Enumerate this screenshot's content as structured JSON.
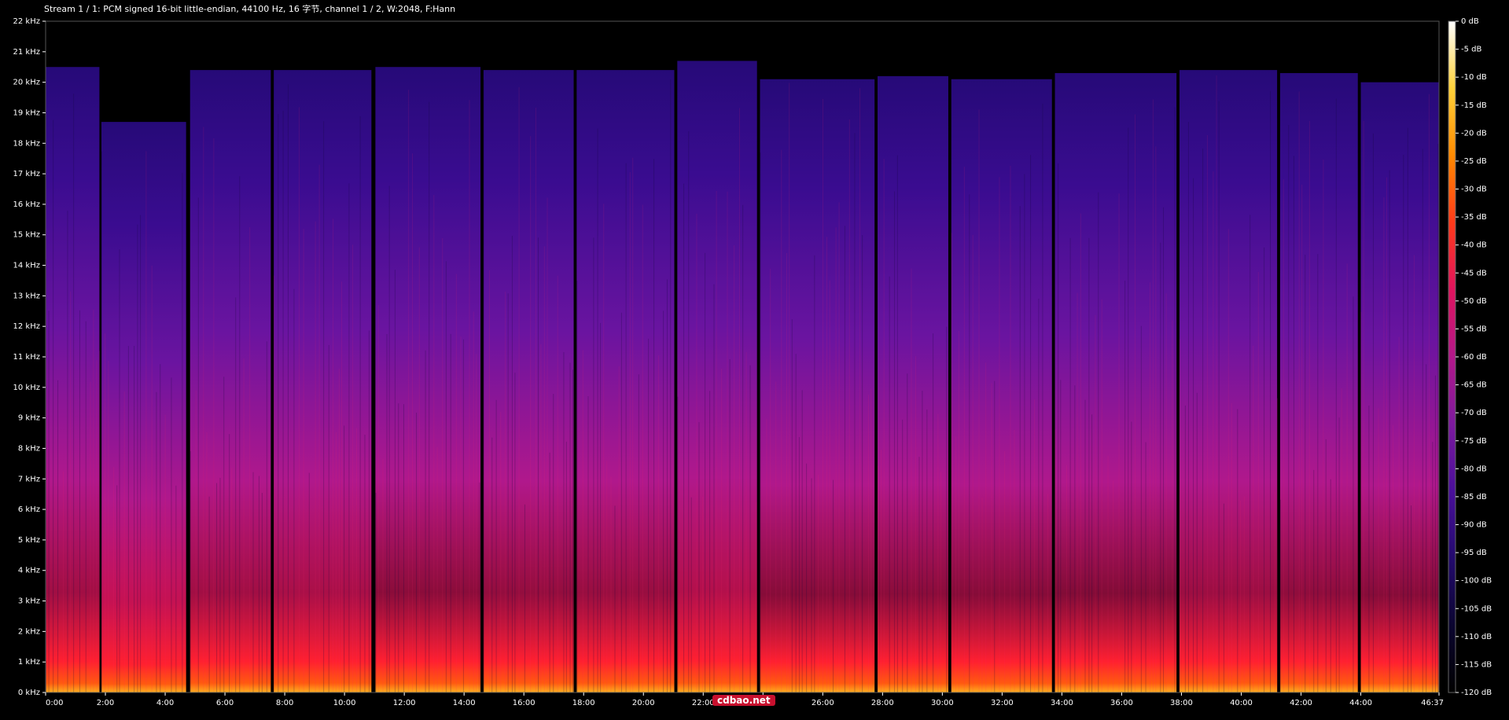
{
  "header": {
    "text": "Stream 1 / 1: PCM signed 16-bit little-endian, 44100 Hz, 16 字节, channel 1 / 2, W:2048, F:Hann"
  },
  "watermark": {
    "text": "cdbao.net"
  },
  "colors": {
    "background": "#000000",
    "text": "#ffffff",
    "colormap": [
      "#000000",
      "#0b0530",
      "#230a6e",
      "#4a0f9a",
      "#7d1a9e",
      "#b3188a",
      "#e0145e",
      "#ff3a1a",
      "#ff8a00",
      "#ffd23a",
      "#ffffff"
    ]
  },
  "chart_data": {
    "type": "heatmap",
    "title": "",
    "xlabel": "",
    "ylabel": "",
    "x_ticks": [
      "0:00",
      "2:00",
      "4:00",
      "6:00",
      "8:00",
      "10:00",
      "12:00",
      "14:00",
      "16:00",
      "18:00",
      "20:00",
      "22:00",
      "24:00",
      "26:00",
      "28:00",
      "30:00",
      "32:00",
      "34:00",
      "36:00",
      "38:00",
      "40:00",
      "42:00",
      "44:00",
      "46:37"
    ],
    "x_tick_seconds": [
      0,
      120,
      240,
      360,
      480,
      600,
      720,
      840,
      960,
      1080,
      1200,
      1320,
      1440,
      1560,
      1680,
      1800,
      1920,
      2040,
      2160,
      2280,
      2400,
      2520,
      2640,
      2797
    ],
    "xlim_seconds": [
      0,
      2797
    ],
    "y_ticks": [
      "0 kHz",
      "1 kHz",
      "2 kHz",
      "3 kHz",
      "4 kHz",
      "5 kHz",
      "6 kHz",
      "7 kHz",
      "8 kHz",
      "9 kHz",
      "10 kHz",
      "11 kHz",
      "12 kHz",
      "13 kHz",
      "14 kHz",
      "15 kHz",
      "16 kHz",
      "17 kHz",
      "18 kHz",
      "19 kHz",
      "20 kHz",
      "21 kHz",
      "22 kHz"
    ],
    "ylim_khz": [
      0,
      22
    ],
    "colorbar_ticks": [
      "0 dB",
      "-5 dB",
      "-10 dB",
      "-15 dB",
      "-20 dB",
      "-25 dB",
      "-30 dB",
      "-35 dB",
      "-40 dB",
      "-45 dB",
      "-50 dB",
      "-55 dB",
      "-60 dB",
      "-65 dB",
      "-70 dB",
      "-75 dB",
      "-80 dB",
      "-85 dB",
      "-90 dB",
      "-95 dB",
      "-100 dB",
      "-105 dB",
      "-110 dB",
      "-115 dB",
      "-120 dB"
    ],
    "colorbar_range_db": [
      -120,
      0
    ],
    "tracks": [
      {
        "start": 0,
        "end": 108,
        "cutoff_khz": 20.5,
        "intensity": 0.72
      },
      {
        "start": 112,
        "end": 282,
        "cutoff_khz": 18.7,
        "intensity": 0.88
      },
      {
        "start": 290,
        "end": 452,
        "cutoff_khz": 20.4,
        "intensity": 0.72
      },
      {
        "start": 458,
        "end": 654,
        "cutoff_khz": 20.4,
        "intensity": 0.76
      },
      {
        "start": 662,
        "end": 873,
        "cutoff_khz": 20.5,
        "intensity": 0.62
      },
      {
        "start": 879,
        "end": 1060,
        "cutoff_khz": 20.4,
        "intensity": 0.66
      },
      {
        "start": 1066,
        "end": 1262,
        "cutoff_khz": 20.4,
        "intensity": 0.68
      },
      {
        "start": 1268,
        "end": 1428,
        "cutoff_khz": 20.7,
        "intensity": 0.8
      },
      {
        "start": 1434,
        "end": 1664,
        "cutoff_khz": 20.1,
        "intensity": 0.6
      },
      {
        "start": 1670,
        "end": 1812,
        "cutoff_khz": 20.2,
        "intensity": 0.62
      },
      {
        "start": 1818,
        "end": 2020,
        "cutoff_khz": 20.1,
        "intensity": 0.6
      },
      {
        "start": 2026,
        "end": 2270,
        "cutoff_khz": 20.3,
        "intensity": 0.58
      },
      {
        "start": 2276,
        "end": 2472,
        "cutoff_khz": 20.4,
        "intensity": 0.7
      },
      {
        "start": 2478,
        "end": 2634,
        "cutoff_khz": 20.3,
        "intensity": 0.64
      },
      {
        "start": 2640,
        "end": 2797,
        "cutoff_khz": 20.0,
        "intensity": 0.6
      }
    ]
  }
}
